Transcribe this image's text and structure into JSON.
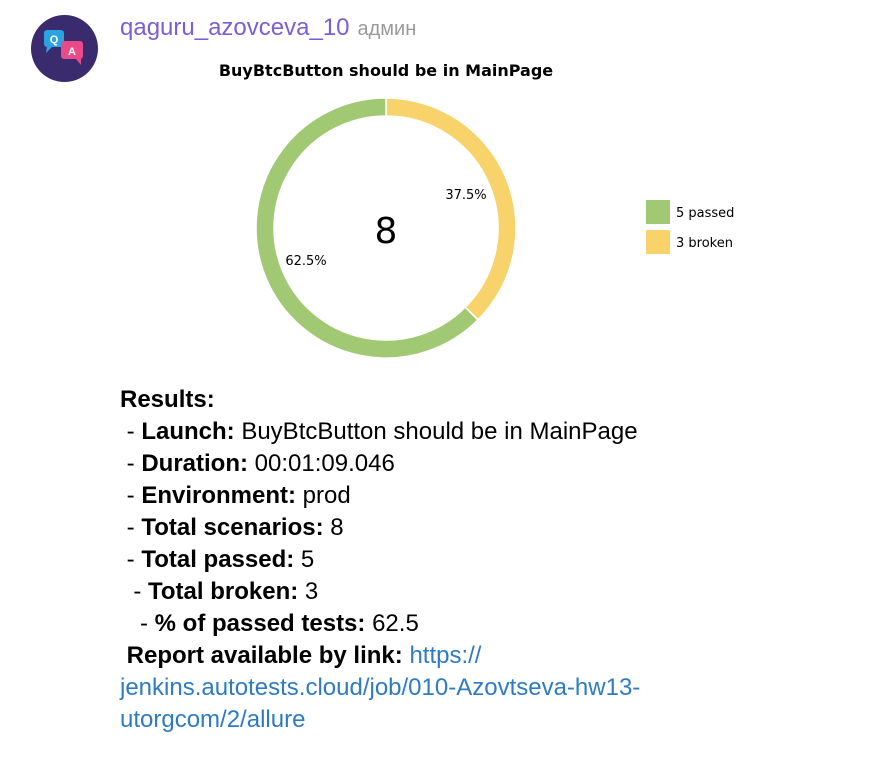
{
  "message": {
    "sender": "qaguru_azovceva_10",
    "role": "админ",
    "avatar_letters": [
      "Q",
      "A"
    ],
    "avatar_colors": {
      "bg": "#3a2a6e",
      "bubble_q": "#2aa3e0",
      "bubble_a": "#e84a8a"
    }
  },
  "chart_data": {
    "type": "pie",
    "title": "BuyBtcButton should be in MainPage",
    "center_label": "8",
    "slices": [
      {
        "name": "passed",
        "value": 5,
        "percent_label": "62.5%",
        "color": "#a1c974"
      },
      {
        "name": "broken",
        "value": 3,
        "percent_label": "37.5%",
        "color": "#f8d36b"
      }
    ],
    "legend": [
      {
        "label": "5 passed",
        "color": "#a1c974"
      },
      {
        "label": "3 broken",
        "color": "#f8d36b"
      }
    ],
    "legend_position": "right",
    "donut": true
  },
  "results": {
    "heading": "Results:",
    "lines": [
      {
        "prefix": " - ",
        "label": "Launch:",
        "value": " BuyBtcButton should be in MainPage"
      },
      {
        "prefix": " - ",
        "label": "Duration:",
        "value": " 00:01:09.046"
      },
      {
        "prefix": " - ",
        "label": "Environment:",
        "value": " prod"
      },
      {
        "prefix": " - ",
        "label": "Total scenarios:",
        "value": " 8"
      },
      {
        "prefix": " - ",
        "label": "Total passed:",
        "value": " 5"
      },
      {
        "prefix": "  - ",
        "label": "Total broken:",
        "value": " 3"
      },
      {
        "prefix": "   - ",
        "label": "% of passed tests:",
        "value": " 62.5"
      }
    ],
    "report_label": "Report available by link:",
    "report_link": "https://jenkins.autotests.cloud/job/010-Azovtseva-hw13-utorgcom/2/allure",
    "report_link_lines": [
      "https://",
      "jenkins.autotests.cloud/job/010-Azovtseva-hw13-",
      "utorgcom/2/allure"
    ]
  }
}
